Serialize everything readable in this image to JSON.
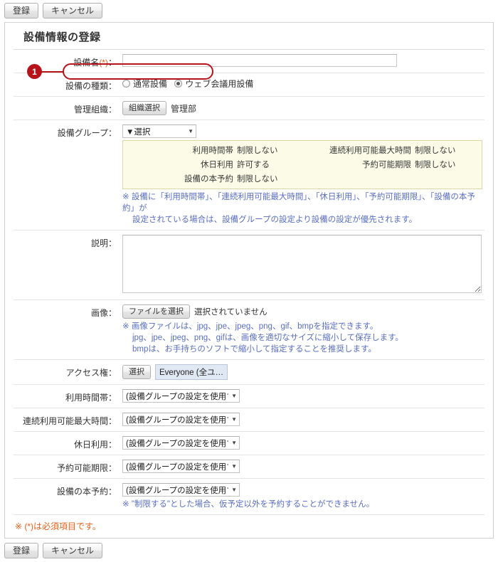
{
  "toolbar": {
    "register_label": "登録",
    "cancel_label": "キャンセル"
  },
  "page": {
    "title": "設備情報の登録"
  },
  "callout": {
    "number": "1"
  },
  "form": {
    "facility_name": {
      "label": "設備名",
      "required_mark": "(*)",
      "colon": "：",
      "value": ""
    },
    "facility_type": {
      "label": "設備の種類",
      "colon": "：",
      "options": [
        {
          "label": "通常設備",
          "checked": false
        },
        {
          "label": "ウェブ会議用設備",
          "checked": true
        }
      ]
    },
    "managing_org": {
      "label": "管理組織",
      "colon": "：",
      "button_label": "組織選択",
      "value": "管理部"
    },
    "facility_group": {
      "label": "設備グループ",
      "colon": "：",
      "selected": "▼選択",
      "info": {
        "left": [
          {
            "label": "利用時間帯",
            "colon": "：",
            "value": "制限しない"
          },
          {
            "label": "休日利用",
            "colon": "：",
            "value": "許可する"
          },
          {
            "label": "設備の本予約",
            "colon": "：",
            "value": "制限しない"
          }
        ],
        "right": [
          {
            "label": "連続利用可能最大時間",
            "colon": "：",
            "value": "制限しない"
          },
          {
            "label": "予約可能期限",
            "colon": "：",
            "value": "制限しない"
          }
        ]
      },
      "note_line1": "※ 設備に「利用時間帯」、「連続利用可能最大時間」、「休日利用」、「予約可能期限」、「設備の本予約」が",
      "note_line2": "設定されている場合は、設備グループの設定より設備の設定が優先されます。"
    },
    "description": {
      "label": "説明",
      "colon": "：",
      "value": ""
    },
    "image": {
      "label": "画像",
      "colon": "：",
      "button_label": "ファイルを選択",
      "file_status": "選択されていません",
      "note_line1": "※ 画像ファイルは、jpg、jpe、jpeg、png、gif、bmpを指定できます。",
      "note_line2": "jpg、jpe、jpeg、png、gifは、画像を適切なサイズに縮小して保存します。",
      "note_line3": "bmpは、お手持ちのソフトで縮小して指定することを推奨します。"
    },
    "access_rights": {
      "label": "アクセス権",
      "colon": "：",
      "button_label": "選択",
      "value": "Everyone (全ユ…"
    },
    "usage_hours": {
      "label": "利用時間帯",
      "colon": "：",
      "selected": "(設備グループの設定を使用する)"
    },
    "max_continuous_hours": {
      "label": "連続利用可能最大時間",
      "colon": "：",
      "selected": "(設備グループの設定を使用する)"
    },
    "holiday_use": {
      "label": "休日利用",
      "colon": "：",
      "selected": "(設備グループの設定を使用する)"
    },
    "reservation_period": {
      "label": "予約可能期限",
      "colon": "：",
      "selected": "(設備グループの設定を使用する)"
    },
    "final_reservation": {
      "label": "設備の本予約",
      "colon": "：",
      "selected": "(設備グループの設定を使用する)",
      "note": "※ \"制限する\"とした場合、仮予定以外を予約することができません。"
    }
  },
  "footer": {
    "required_note": "※ (*)は必須項目です。"
  }
}
